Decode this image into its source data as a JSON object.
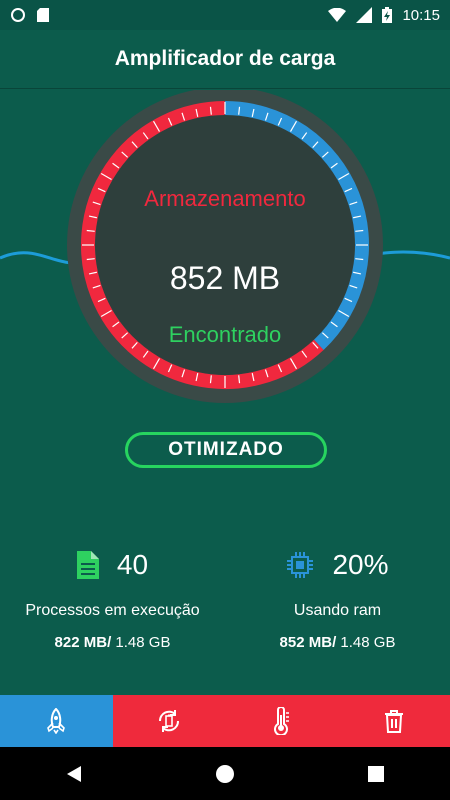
{
  "status_bar": {
    "time": "10:15"
  },
  "header": {
    "title": "Amplificador de carga"
  },
  "gauge": {
    "label_top": "Armazenamento",
    "value": "852 MB",
    "label_bottom": "Encontrado",
    "fill_fraction": 0.62,
    "colors": {
      "used": "#f0283e",
      "free": "#2a93d8",
      "found": "#2ed160"
    }
  },
  "optimize_button": {
    "label": "OTIMIZADO"
  },
  "stats": {
    "processes": {
      "icon": "document-icon",
      "count": "40",
      "label": "Processos em execução",
      "used": "822 MB/",
      "total": " 1.48 GB"
    },
    "ram": {
      "icon": "chip-icon",
      "percent": "20%",
      "label": "Usando ram",
      "used": "852 MB/",
      "total": " 1.48 GB"
    }
  },
  "tabs": [
    {
      "name": "boost",
      "icon": "rocket-icon",
      "active": true
    },
    {
      "name": "battery",
      "icon": "battery-cycle-icon",
      "active": false
    },
    {
      "name": "cpu-cooler",
      "icon": "thermometer-icon",
      "active": false
    },
    {
      "name": "cleaner",
      "icon": "trash-icon",
      "active": false
    }
  ]
}
